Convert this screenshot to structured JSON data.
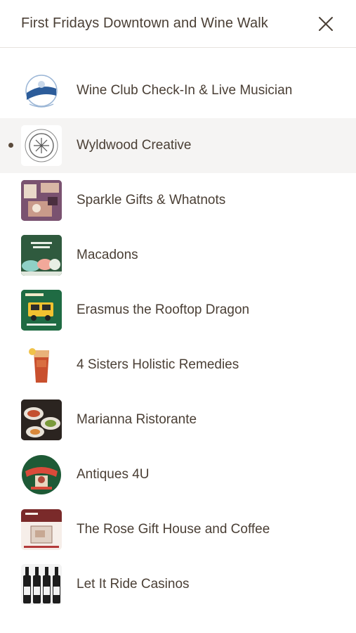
{
  "header": {
    "title": "First Fridays Downtown and Wine Walk",
    "close_icon": "close-icon"
  },
  "list": {
    "active_index": 1,
    "items": [
      {
        "label": "Wine Club Check-In & Live Musician",
        "thumb": "market-logo"
      },
      {
        "label": "Wyldwood Creative",
        "thumb": "wyldwood-logo"
      },
      {
        "label": "Sparkle Gifts & Whatnots",
        "thumb": "gifts-photo"
      },
      {
        "label": "Macadons",
        "thumb": "macadons-soft-opening"
      },
      {
        "label": "Erasmus the Rooftop Dragon",
        "thumb": "food-truck-flyer"
      },
      {
        "label": "4 Sisters Holistic Remedies",
        "thumb": "iced-tea-photo"
      },
      {
        "label": "Marianna Ristorante",
        "thumb": "restaurant-plates-photo"
      },
      {
        "label": "Antiques 4U",
        "thumb": "antiques-round-logo"
      },
      {
        "label": "The Rose Gift House and Coffee",
        "thumb": "gift-house-card"
      },
      {
        "label": "Let It Ride Casinos",
        "thumb": "wine-bottles-photo"
      }
    ]
  },
  "colors": {
    "text": "#4a3f35",
    "active_row": "#f5f4f3",
    "divider": "#e6e2de"
  }
}
